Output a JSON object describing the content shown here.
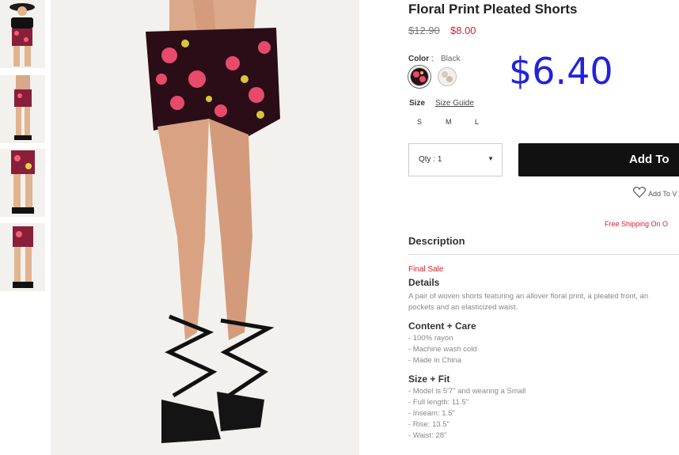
{
  "product": {
    "title": "Floral Print Pleated Shorts",
    "original_price": "$12.90",
    "sale_price": "$8.00",
    "overlay_price": "$6.40"
  },
  "color": {
    "label": "Color",
    "separator": ":",
    "selected": "Black"
  },
  "size": {
    "label": "Size",
    "guide_label": "Size Guide",
    "options": [
      "S",
      "M",
      "L"
    ]
  },
  "quantity": {
    "label": "Qty : 1"
  },
  "actions": {
    "add_to_bag_label": "Add To",
    "wishlist_label": "Add To V"
  },
  "shipping_note": "Free Shipping On O",
  "description": {
    "heading": "Description",
    "final_sale": "Final Sale",
    "details_heading": "Details",
    "details_lines": [
      "A pair of woven shorts featuring an allover floral print, a pleated front, an",
      "pockets and an elasticized waist."
    ],
    "content_heading": "Content + Care",
    "content_lines": [
      "- 100% rayon",
      "- Machine wash cold",
      "- Made in China"
    ],
    "fit_heading": "Size + Fit",
    "fit_lines": [
      "- Model is 5'7\" and wearing a Small",
      "- Full length: 11.5\"",
      "- Inseam: 1.5\"",
      "- Rise: 13.5\"",
      "- Waist: 28\""
    ]
  },
  "colors": {
    "sale_red": "#d6202d",
    "overlay_blue": "#2222dd",
    "button_black": "#111111"
  }
}
